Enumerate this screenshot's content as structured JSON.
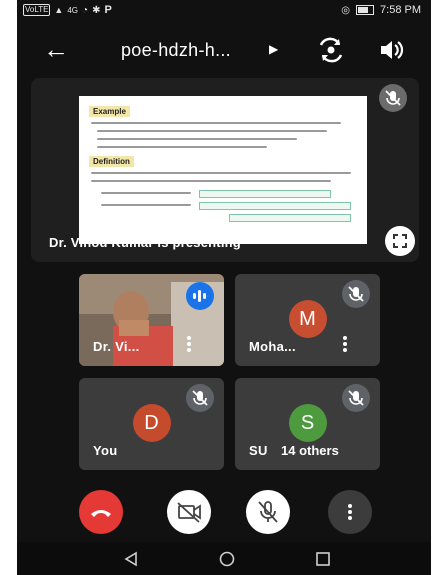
{
  "status_bar": {
    "carrier": "VoLTE",
    "signal": "4G",
    "time": "7:58 PM"
  },
  "header": {
    "title": "poe-hdzh-h..."
  },
  "presentation": {
    "caption": "Dr. Vinod Kumar is presenting",
    "slide": {
      "example_label": "Example",
      "definition_label": "Definition"
    }
  },
  "participants": [
    {
      "name": "Dr. Vi...",
      "initial": "",
      "avatar_color": "",
      "has_video": true,
      "speaking": true
    },
    {
      "name": "Moha...",
      "initial": "M",
      "avatar_color": "#c84e31"
    },
    {
      "name": "You",
      "initial": "D",
      "avatar_color": "#c44b2b"
    },
    {
      "name": "SU",
      "initial": "S",
      "avatar_color": "#4e9a3e",
      "overlay_text": "14 others"
    }
  ],
  "controls": [
    {
      "icon": "end-call-icon",
      "color": "#e53935"
    },
    {
      "icon": "camera-off-icon",
      "color": "#ffffff"
    },
    {
      "icon": "mic-off-icon",
      "color": "#ffffff"
    },
    {
      "icon": "more-options-icon",
      "color": "#3c3c3c"
    }
  ],
  "navbar": {
    "icons": [
      "back-triangle-icon",
      "home-circle-icon",
      "recents-square-icon"
    ]
  }
}
